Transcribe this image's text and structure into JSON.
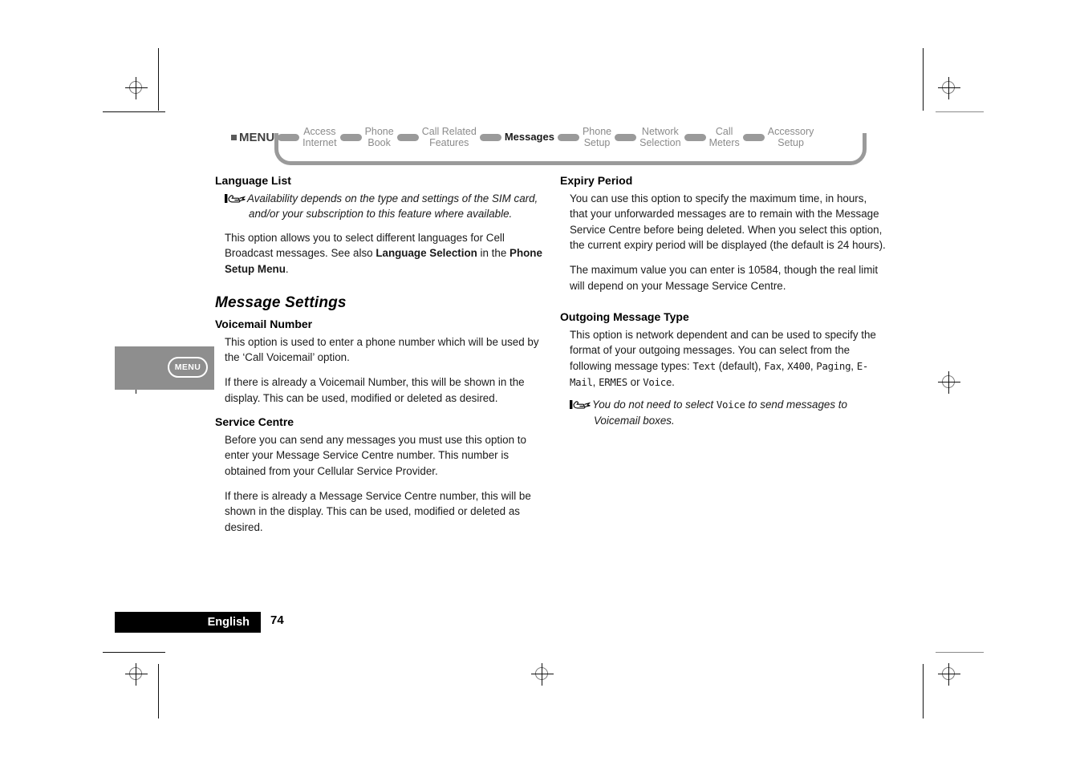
{
  "nav": {
    "menu_label": "MENU",
    "items": [
      {
        "line1": "Access",
        "line2": "Internet",
        "active": false
      },
      {
        "line1": "Phone",
        "line2": "Book",
        "active": false
      },
      {
        "line1": "Call Related",
        "line2": "Features",
        "active": false
      },
      {
        "line1": "Messages",
        "line2": "",
        "active": true
      },
      {
        "line1": "Phone",
        "line2": "Setup",
        "active": false
      },
      {
        "line1": "Network",
        "line2": "Selection",
        "active": false
      },
      {
        "line1": "Call",
        "line2": "Meters",
        "active": false
      },
      {
        "line1": "Accessory",
        "line2": "Setup",
        "active": false
      }
    ]
  },
  "left_column": {
    "language_list": {
      "heading": "Language List",
      "note": "Availability depends on the type and settings of the SIM card, and/or your subscription to this feature where available.",
      "para_1a": "This option allows you to select different languages for Cell Broadcast messages. See also ",
      "para_1_bold1": "Language Selection",
      "para_1b": " in the ",
      "para_1_bold2": "Phone Setup Menu",
      "para_1c": "."
    },
    "message_settings": {
      "heading": "Message Settings"
    },
    "voicemail_number": {
      "heading": "Voicemail Number",
      "para_1": "This option is used to enter a phone number which will be used by the ‘Call Voicemail’ option.",
      "para_2": "If there is already a Voicemail Number, this will be shown in the display. This can be used, modified or deleted as desired."
    },
    "service_centre": {
      "heading": "Service Centre",
      "para_1": "Before you can send any messages you must use this option to enter your Message Service Centre number. This number is obtained from your Cellular Service Provider.",
      "para_2": "If there is already a Message Service Centre number, this will be shown in the display. This can be used, modified or deleted as desired."
    }
  },
  "right_column": {
    "expiry_period": {
      "heading": "Expiry Period",
      "para_1": "You can use this option to specify the maximum time, in hours, that your unforwarded messages are to remain with the Message Service Centre before being deleted. When you select this option, the current expiry period will be displayed (the default is 24 hours).",
      "para_2": "The maximum value you can enter is 10584, though the real limit will depend on your Message Service Centre."
    },
    "outgoing_message_type": {
      "heading": "Outgoing Message Type",
      "para_1a": "This option is network dependent and can be used to specify the format of your outgoing messages. You can select from the following message types: ",
      "type_text": "Text",
      "mid_default": " (default), ",
      "type_fax": "Fax",
      "sep_1": ", ",
      "type_x400": "X400",
      "sep_2": ", ",
      "type_paging": "Paging",
      "sep_3": ", ",
      "type_email": "E-Mail",
      "sep_4": ", ",
      "type_ermes": "ERMES",
      "sep_5": " or ",
      "type_voice": "Voice",
      "sep_6": ".",
      "note_a": "You do not need to select ",
      "note_lcd": "Voice",
      "note_b": " to send messages to Voicemail boxes."
    }
  },
  "margin_graphic": {
    "key_label": "MENU"
  },
  "footer": {
    "language": "English",
    "page_number": "74"
  },
  "colors": {
    "nav_gray": "#9a9a9a",
    "nav_text_gray": "#8b8b8b",
    "margin_box_gray": "#8e8e8e",
    "footer_black": "#000000"
  }
}
